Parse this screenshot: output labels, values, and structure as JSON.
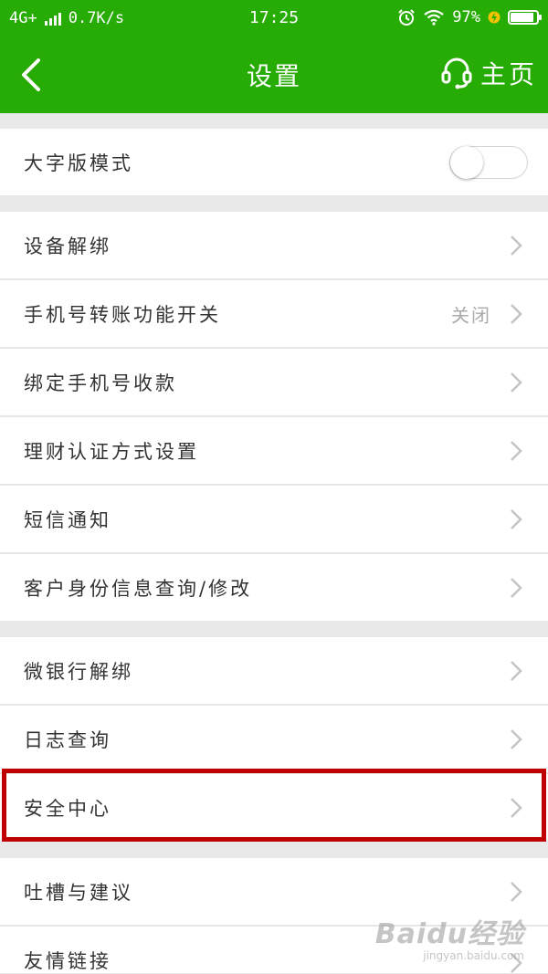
{
  "status_bar": {
    "network": "4G+",
    "speed": "0.7K/s",
    "time": "17:25",
    "battery_percent": "97%",
    "battery_level": 0.97,
    "icons": [
      "signal-icon",
      "alarm-icon",
      "wifi-icon",
      "charging-icon",
      "battery-icon"
    ]
  },
  "navbar": {
    "title": "设置",
    "home_label": "主页",
    "icons": [
      "back-icon",
      "headset-icon"
    ]
  },
  "settings": {
    "large_font": {
      "label": "大字版模式",
      "enabled": false
    },
    "device_unbind": {
      "label": "设备解绑"
    },
    "phone_transfer": {
      "label": "手机号转账功能开关",
      "value": "关闭"
    },
    "bind_phone_collect": {
      "label": "绑定手机号收款"
    },
    "finance_auth": {
      "label": "理财认证方式设置"
    },
    "sms_notify": {
      "label": "短信通知"
    },
    "customer_identity": {
      "label": "客户身份信息查询/修改"
    },
    "wechat_bank_unbind": {
      "label": "微银行解绑"
    },
    "log_query": {
      "label": "日志查询"
    },
    "security_center": {
      "label": "安全中心"
    },
    "feedback": {
      "label": "吐槽与建议"
    },
    "friend_links": {
      "label": "友情链接"
    }
  },
  "watermark": {
    "logo": "Baidu经验",
    "site": "jingyan.baidu.com"
  },
  "colors": {
    "brand_green": "#26ac05",
    "highlight_red": "#c00000",
    "background": "#e9e9e9"
  }
}
